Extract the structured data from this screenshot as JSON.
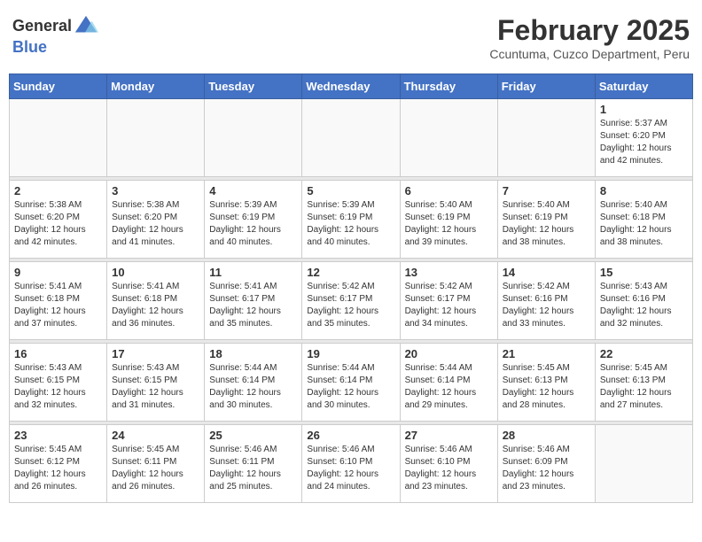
{
  "logo": {
    "general": "General",
    "blue": "Blue"
  },
  "header": {
    "month_year": "February 2025",
    "location": "Ccuntuma, Cuzco Department, Peru"
  },
  "weekdays": [
    "Sunday",
    "Monday",
    "Tuesday",
    "Wednesday",
    "Thursday",
    "Friday",
    "Saturday"
  ],
  "weeks": [
    [
      {
        "day": "",
        "info": ""
      },
      {
        "day": "",
        "info": ""
      },
      {
        "day": "",
        "info": ""
      },
      {
        "day": "",
        "info": ""
      },
      {
        "day": "",
        "info": ""
      },
      {
        "day": "",
        "info": ""
      },
      {
        "day": "1",
        "info": "Sunrise: 5:37 AM\nSunset: 6:20 PM\nDaylight: 12 hours and 42 minutes."
      }
    ],
    [
      {
        "day": "2",
        "info": "Sunrise: 5:38 AM\nSunset: 6:20 PM\nDaylight: 12 hours and 42 minutes."
      },
      {
        "day": "3",
        "info": "Sunrise: 5:38 AM\nSunset: 6:20 PM\nDaylight: 12 hours and 41 minutes."
      },
      {
        "day": "4",
        "info": "Sunrise: 5:39 AM\nSunset: 6:19 PM\nDaylight: 12 hours and 40 minutes."
      },
      {
        "day": "5",
        "info": "Sunrise: 5:39 AM\nSunset: 6:19 PM\nDaylight: 12 hours and 40 minutes."
      },
      {
        "day": "6",
        "info": "Sunrise: 5:40 AM\nSunset: 6:19 PM\nDaylight: 12 hours and 39 minutes."
      },
      {
        "day": "7",
        "info": "Sunrise: 5:40 AM\nSunset: 6:19 PM\nDaylight: 12 hours and 38 minutes."
      },
      {
        "day": "8",
        "info": "Sunrise: 5:40 AM\nSunset: 6:18 PM\nDaylight: 12 hours and 38 minutes."
      }
    ],
    [
      {
        "day": "9",
        "info": "Sunrise: 5:41 AM\nSunset: 6:18 PM\nDaylight: 12 hours and 37 minutes."
      },
      {
        "day": "10",
        "info": "Sunrise: 5:41 AM\nSunset: 6:18 PM\nDaylight: 12 hours and 36 minutes."
      },
      {
        "day": "11",
        "info": "Sunrise: 5:41 AM\nSunset: 6:17 PM\nDaylight: 12 hours and 35 minutes."
      },
      {
        "day": "12",
        "info": "Sunrise: 5:42 AM\nSunset: 6:17 PM\nDaylight: 12 hours and 35 minutes."
      },
      {
        "day": "13",
        "info": "Sunrise: 5:42 AM\nSunset: 6:17 PM\nDaylight: 12 hours and 34 minutes."
      },
      {
        "day": "14",
        "info": "Sunrise: 5:42 AM\nSunset: 6:16 PM\nDaylight: 12 hours and 33 minutes."
      },
      {
        "day": "15",
        "info": "Sunrise: 5:43 AM\nSunset: 6:16 PM\nDaylight: 12 hours and 32 minutes."
      }
    ],
    [
      {
        "day": "16",
        "info": "Sunrise: 5:43 AM\nSunset: 6:15 PM\nDaylight: 12 hours and 32 minutes."
      },
      {
        "day": "17",
        "info": "Sunrise: 5:43 AM\nSunset: 6:15 PM\nDaylight: 12 hours and 31 minutes."
      },
      {
        "day": "18",
        "info": "Sunrise: 5:44 AM\nSunset: 6:14 PM\nDaylight: 12 hours and 30 minutes."
      },
      {
        "day": "19",
        "info": "Sunrise: 5:44 AM\nSunset: 6:14 PM\nDaylight: 12 hours and 30 minutes."
      },
      {
        "day": "20",
        "info": "Sunrise: 5:44 AM\nSunset: 6:14 PM\nDaylight: 12 hours and 29 minutes."
      },
      {
        "day": "21",
        "info": "Sunrise: 5:45 AM\nSunset: 6:13 PM\nDaylight: 12 hours and 28 minutes."
      },
      {
        "day": "22",
        "info": "Sunrise: 5:45 AM\nSunset: 6:13 PM\nDaylight: 12 hours and 27 minutes."
      }
    ],
    [
      {
        "day": "23",
        "info": "Sunrise: 5:45 AM\nSunset: 6:12 PM\nDaylight: 12 hours and 26 minutes."
      },
      {
        "day": "24",
        "info": "Sunrise: 5:45 AM\nSunset: 6:11 PM\nDaylight: 12 hours and 26 minutes."
      },
      {
        "day": "25",
        "info": "Sunrise: 5:46 AM\nSunset: 6:11 PM\nDaylight: 12 hours and 25 minutes."
      },
      {
        "day": "26",
        "info": "Sunrise: 5:46 AM\nSunset: 6:10 PM\nDaylight: 12 hours and 24 minutes."
      },
      {
        "day": "27",
        "info": "Sunrise: 5:46 AM\nSunset: 6:10 PM\nDaylight: 12 hours and 23 minutes."
      },
      {
        "day": "28",
        "info": "Sunrise: 5:46 AM\nSunset: 6:09 PM\nDaylight: 12 hours and 23 minutes."
      },
      {
        "day": "",
        "info": ""
      }
    ]
  ]
}
